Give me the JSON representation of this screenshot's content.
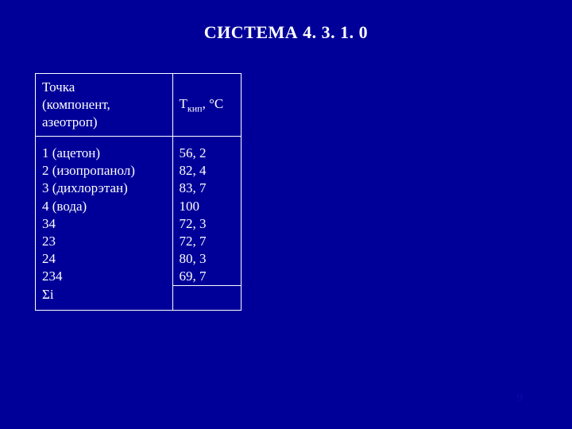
{
  "title": "СИСТЕМА 4. 3. 1. 0",
  "table": {
    "header": {
      "col1_l1": "Точка",
      "col1_l2": "(компонент,",
      "col1_l3": " азеотроп)",
      "col2_prefix": "Т",
      "col2_sub": "кип",
      "col2_suffix": ", °C"
    },
    "rows": [
      {
        "c1": "1 (ацетон)",
        "c2": "56, 2"
      },
      {
        "c1": "2 (изопропанол)",
        "c2": "82, 4"
      },
      {
        "c1": "3 (дихлорэтан)",
        "c2": "83, 7"
      },
      {
        "c1": "4 (вода)",
        "c2": "100"
      },
      {
        "c1": "34",
        "c2": " 72, 3"
      },
      {
        "c1": "23",
        "c2": "72, 7"
      },
      {
        "c1": "24",
        "c2": "80, 3"
      },
      {
        "c1": "234",
        "c2": "69, 7"
      }
    ],
    "sigma": {
      "c1": "Σi",
      "c2": ""
    }
  },
  "page_number": "9",
  "chart_data": {
    "type": "table",
    "title": "СИСТЕМА 4. 3. 1. 0",
    "columns": [
      "Точка (компонент, азеотроп)",
      "Ткип, °C"
    ],
    "rows": [
      [
        "1 (ацетон)",
        56.2
      ],
      [
        "2 (изопропанол)",
        82.4
      ],
      [
        "3 (дихлорэтан)",
        83.7
      ],
      [
        "4 (вода)",
        100
      ],
      [
        "34",
        72.3
      ],
      [
        "23",
        72.7
      ],
      [
        "24",
        80.3
      ],
      [
        "234",
        69.7
      ],
      [
        "Σi",
        null
      ]
    ]
  }
}
